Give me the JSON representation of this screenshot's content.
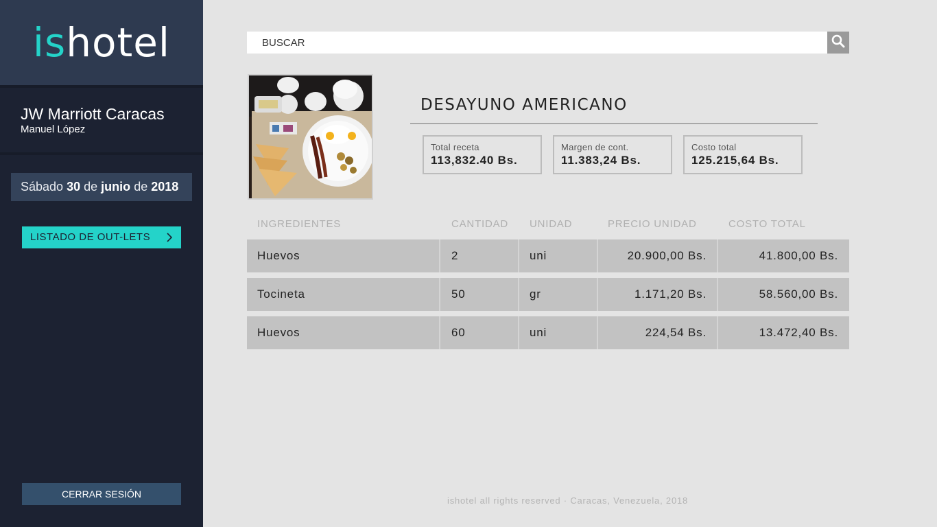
{
  "app": {
    "logo_accent": "is",
    "logo_main": "hotel"
  },
  "sidebar": {
    "hotel_name": "JW Marriott Caracas",
    "user_name": "Manuel López",
    "date": {
      "weekday": "Sábado",
      "day": "30",
      "de1": "de",
      "month": "junio",
      "de2": "de",
      "year": "2018"
    },
    "outlets_label": "LISTADO DE OUT-LETS",
    "logout_label": "CERRAR SESIÓN"
  },
  "search": {
    "placeholder": "BUSCAR"
  },
  "recipe": {
    "title": "DESAYUNO AMERICANO",
    "stats": [
      {
        "label": "Total receta",
        "value": "113,832.40 Bs."
      },
      {
        "label": "Margen de cont.",
        "value": "11.383,24 Bs."
      },
      {
        "label": "Costo total",
        "value": "125.215,64 Bs."
      }
    ]
  },
  "table": {
    "headers": [
      "INGREDIENTES",
      "CANTIDAD",
      "UNIDAD",
      "PRECIO UNIDAD",
      "COSTO TOTAL"
    ],
    "rows": [
      {
        "ingredient": "Huevos",
        "qty": "2",
        "unit": "uni",
        "unit_price": "20.900,00 Bs.",
        "total": "41.800,00 Bs."
      },
      {
        "ingredient": "Tocineta",
        "qty": "50",
        "unit": "gr",
        "unit_price": "1.171,20 Bs.",
        "total": "58.560,00 Bs."
      },
      {
        "ingredient": "Huevos",
        "qty": "60",
        "unit": "uni",
        "unit_price": "224,54 Bs.",
        "total": "13.472,40 Bs."
      }
    ]
  },
  "footer": {
    "text": "ishotel all rights reserved · Caracas, Venezuela, 2018"
  },
  "colors": {
    "accent": "#24d3c9",
    "sidebar_bg": "#1c2232",
    "logo_bg": "#2e3a50",
    "main_bg": "#e4e4e4",
    "row_bg": "#c2c2c2",
    "logout_bg": "#34506c"
  },
  "icons": {
    "search": "search-icon",
    "outlets_chevron": "chevron-right-icon"
  }
}
